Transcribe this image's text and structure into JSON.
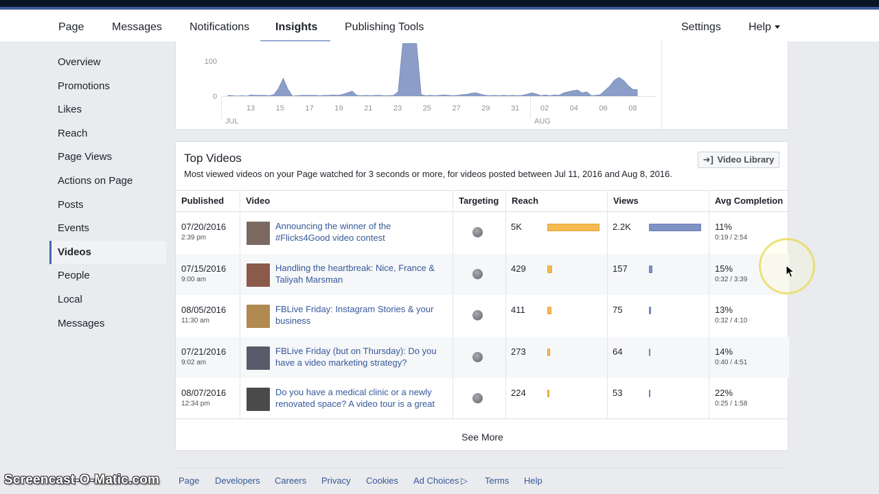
{
  "nav": {
    "tabs": [
      {
        "label": "Page"
      },
      {
        "label": "Messages"
      },
      {
        "label": "Notifications"
      },
      {
        "label": "Insights"
      },
      {
        "label": "Publishing Tools"
      }
    ],
    "settings": "Settings",
    "help": "Help"
  },
  "sidebar": {
    "items": [
      {
        "label": "Overview"
      },
      {
        "label": "Promotions"
      },
      {
        "label": "Likes"
      },
      {
        "label": "Reach"
      },
      {
        "label": "Page Views"
      },
      {
        "label": "Actions on Page"
      },
      {
        "label": "Posts"
      },
      {
        "label": "Events"
      },
      {
        "label": "Videos",
        "active": true
      },
      {
        "label": "People"
      },
      {
        "label": "Local"
      },
      {
        "label": "Messages"
      }
    ]
  },
  "chart": {
    "y_ticks": [
      "100",
      "0"
    ],
    "x_ticks": [
      "13",
      "15",
      "17",
      "19",
      "21",
      "23",
      "25",
      "27",
      "29",
      "31",
      "02",
      "04",
      "06",
      "08"
    ],
    "month_labels": [
      "JUL",
      "AUG"
    ],
    "fill_color": "#8c9ec8",
    "points": [
      2,
      1,
      0,
      1,
      0,
      3,
      2,
      2,
      2,
      1,
      4,
      22,
      50,
      20,
      0,
      1,
      2,
      2,
      2,
      2,
      1,
      2,
      2,
      3,
      2,
      5,
      9,
      14,
      2,
      1,
      2,
      1,
      2,
      2,
      1,
      1,
      2,
      12,
      150,
      150,
      150,
      150,
      4,
      1,
      2,
      1,
      2,
      3,
      2,
      1,
      2,
      4,
      5,
      8,
      9,
      5,
      2,
      1,
      2,
      1,
      2,
      1,
      2,
      1,
      2,
      5,
      9,
      6,
      1,
      3,
      1,
      3,
      2,
      9,
      12,
      15,
      17,
      9,
      12,
      1,
      2,
      4,
      16,
      28,
      45,
      53,
      45,
      30,
      19,
      18
    ],
    "value_max": 150
  },
  "top_videos": {
    "title": "Top Videos",
    "subtitle": "Most viewed videos on your Page watched for 3 seconds or more, for videos posted between Jul 11, 2016 and Aug 8, 2016.",
    "library_button": "Video Library",
    "columns": [
      "Published",
      "Video",
      "Targeting",
      "Reach",
      "Views",
      "Avg Completion"
    ],
    "max_reach": 5000,
    "max_views": 2200,
    "rows": [
      {
        "date": "07/20/2016",
        "time": "2:39 pm",
        "title": "Announcing the winner of the #Flicks4Good video contest",
        "reach_label": "5K",
        "reach": 5000,
        "views_label": "2.2K",
        "views": 2200,
        "completion": "11%",
        "duration": "0:19 / 2:54",
        "thumb": "#7a6a62"
      },
      {
        "date": "07/15/2016",
        "time": "9:00 am",
        "title": "Handling the heartbreak: Nice, France & Taliyah Marsman",
        "reach_label": "429",
        "reach": 429,
        "views_label": "157",
        "views": 157,
        "completion": "15%",
        "duration": "0:32 / 3:39",
        "thumb": "#8a5a4a"
      },
      {
        "date": "08/05/2016",
        "time": "11:30 am",
        "title": "FBLive Friday: Instagram Stories & your business",
        "reach_label": "411",
        "reach": 411,
        "views_label": "75",
        "views": 75,
        "completion": "13%",
        "duration": "0:32 / 4:10",
        "thumb": "#b08a50"
      },
      {
        "date": "07/21/2016",
        "time": "9:02 am",
        "title": "FBLive Friday (but on Thursday): Do you have a video marketing strategy?",
        "reach_label": "273",
        "reach": 273,
        "views_label": "64",
        "views": 64,
        "completion": "14%",
        "duration": "0:40 / 4:51",
        "thumb": "#5a5a6a"
      },
      {
        "date": "08/07/2016",
        "time": "12:34 pm",
        "title": "Do you have a medical clinic or a newly renovated space? A video tour is a great",
        "reach_label": "224",
        "reach": 224,
        "views_label": "53",
        "views": 53,
        "completion": "22%",
        "duration": "0:25 / 1:58",
        "thumb": "#4a4a4a"
      }
    ],
    "see_more": "See More"
  },
  "footer": {
    "links": [
      "Page",
      "Developers",
      "Careers",
      "Privacy",
      "Cookies",
      "Ad Choices",
      "Terms",
      "Help"
    ]
  },
  "watermark": "Screencast-O-Matic.com",
  "colors": {
    "accent": "#4267b2",
    "link": "#365899",
    "reach_bar": "#f7b951",
    "views_bar": "#7e92c4"
  }
}
